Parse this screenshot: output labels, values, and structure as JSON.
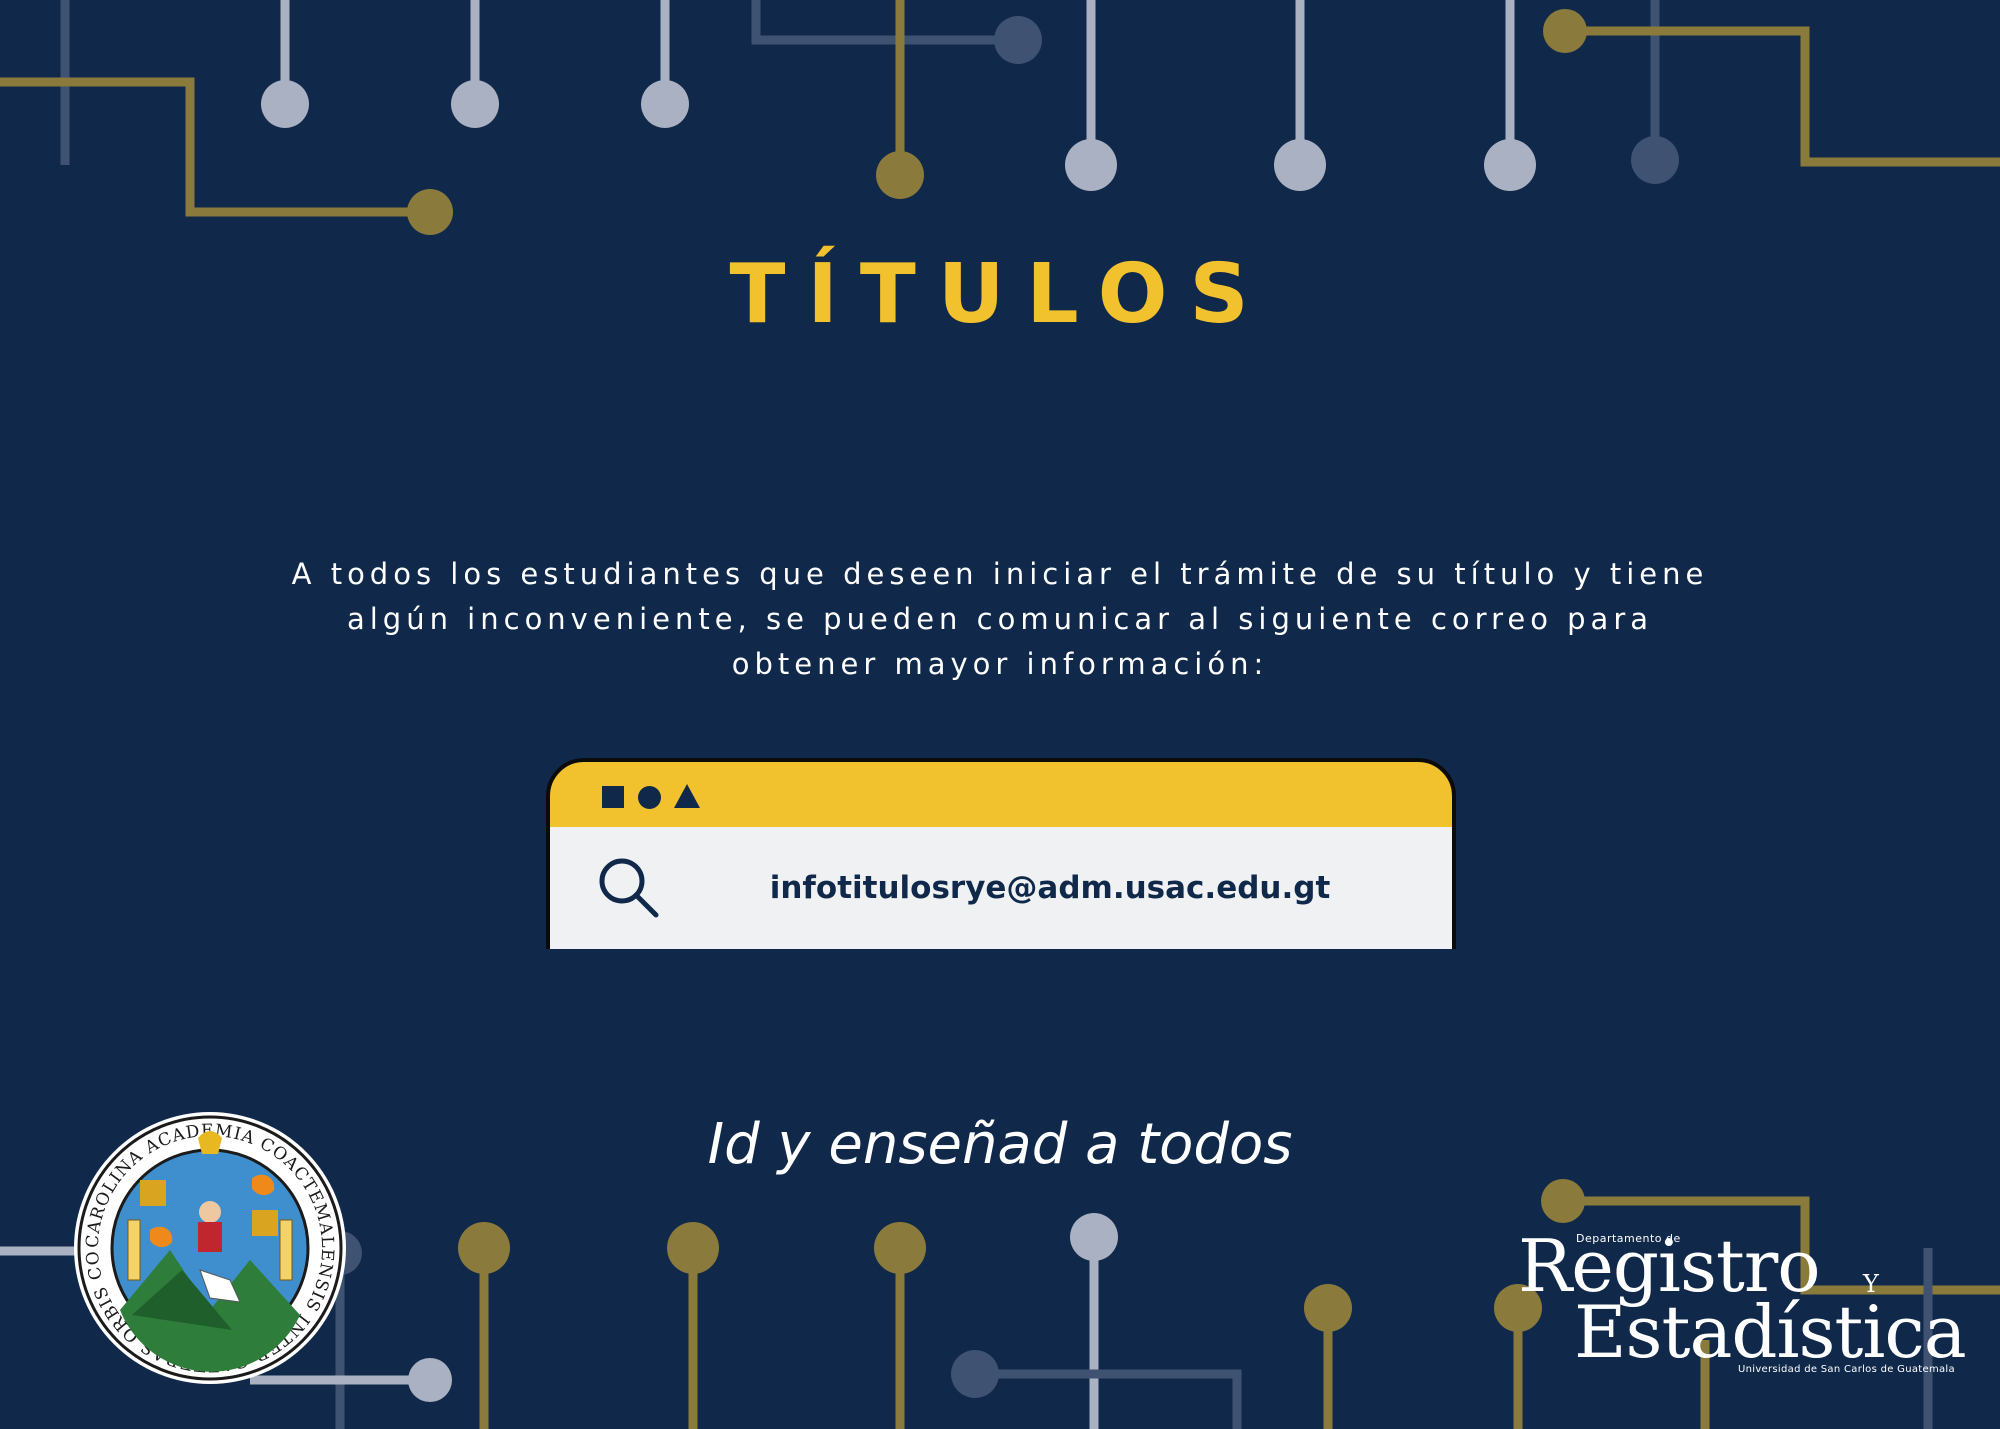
{
  "colors": {
    "background": "#10294a",
    "accent_gold": "#f2c12e",
    "line_gold": "#8a7a3c",
    "line_gray": "#a9b1c2",
    "line_dim": "#3f5272",
    "card_body": "#f0f1f3"
  },
  "title": "TÍTULOS",
  "body_text": "A todos los estudiantes que deseen iniciar el trámite de su título y tiene algún inconveniente, se pueden comunicar al siguiente correo para obtener mayor información:",
  "search_box": {
    "window_icons": [
      "square-icon",
      "circle-icon",
      "triangle-icon"
    ],
    "icon": "search-icon",
    "email": "infotitulosrye@adm.usac.edu.gt"
  },
  "motto": "Id y enseñad a todos",
  "seal": {
    "ring_text": "CAROLINA ACADEMIA COACTEMALENSIS INTER CAETERAS ORBIS CONSPICUA"
  },
  "dept_logo": {
    "small": "Departamento de",
    "line1": "Registro",
    "conj": "Y",
    "line2": "Estadística",
    "sub": "Universidad de San Carlos de Guatemala"
  }
}
